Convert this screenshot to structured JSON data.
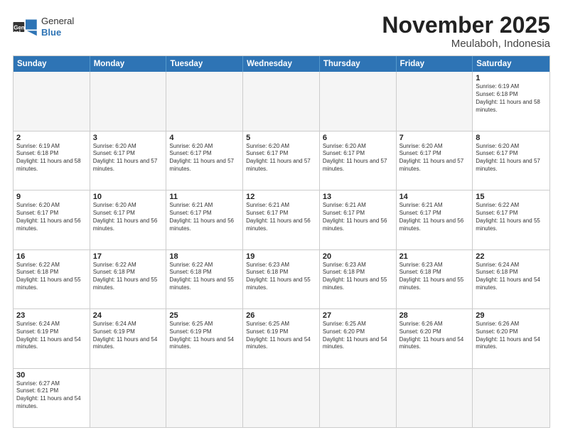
{
  "header": {
    "logo": {
      "general": "General",
      "blue": "Blue"
    },
    "title": "November 2025",
    "location": "Meulaboh, Indonesia"
  },
  "days_of_week": [
    "Sunday",
    "Monday",
    "Tuesday",
    "Wednesday",
    "Thursday",
    "Friday",
    "Saturday"
  ],
  "weeks": [
    [
      {
        "day": "",
        "empty": true
      },
      {
        "day": "",
        "empty": true
      },
      {
        "day": "",
        "empty": true
      },
      {
        "day": "",
        "empty": true
      },
      {
        "day": "",
        "empty": true
      },
      {
        "day": "",
        "empty": true
      },
      {
        "day": "1",
        "sunrise": "6:19 AM",
        "sunset": "6:18 PM",
        "daylight": "11 hours and 58 minutes."
      }
    ],
    [
      {
        "day": "2",
        "sunrise": "6:19 AM",
        "sunset": "6:18 PM",
        "daylight": "11 hours and 58 minutes."
      },
      {
        "day": "3",
        "sunrise": "6:20 AM",
        "sunset": "6:17 PM",
        "daylight": "11 hours and 57 minutes."
      },
      {
        "day": "4",
        "sunrise": "6:20 AM",
        "sunset": "6:17 PM",
        "daylight": "11 hours and 57 minutes."
      },
      {
        "day": "5",
        "sunrise": "6:20 AM",
        "sunset": "6:17 PM",
        "daylight": "11 hours and 57 minutes."
      },
      {
        "day": "6",
        "sunrise": "6:20 AM",
        "sunset": "6:17 PM",
        "daylight": "11 hours and 57 minutes."
      },
      {
        "day": "7",
        "sunrise": "6:20 AM",
        "sunset": "6:17 PM",
        "daylight": "11 hours and 57 minutes."
      },
      {
        "day": "8",
        "sunrise": "6:20 AM",
        "sunset": "6:17 PM",
        "daylight": "11 hours and 57 minutes."
      }
    ],
    [
      {
        "day": "9",
        "sunrise": "6:20 AM",
        "sunset": "6:17 PM",
        "daylight": "11 hours and 56 minutes."
      },
      {
        "day": "10",
        "sunrise": "6:20 AM",
        "sunset": "6:17 PM",
        "daylight": "11 hours and 56 minutes."
      },
      {
        "day": "11",
        "sunrise": "6:21 AM",
        "sunset": "6:17 PM",
        "daylight": "11 hours and 56 minutes."
      },
      {
        "day": "12",
        "sunrise": "6:21 AM",
        "sunset": "6:17 PM",
        "daylight": "11 hours and 56 minutes."
      },
      {
        "day": "13",
        "sunrise": "6:21 AM",
        "sunset": "6:17 PM",
        "daylight": "11 hours and 56 minutes."
      },
      {
        "day": "14",
        "sunrise": "6:21 AM",
        "sunset": "6:17 PM",
        "daylight": "11 hours and 56 minutes."
      },
      {
        "day": "15",
        "sunrise": "6:22 AM",
        "sunset": "6:17 PM",
        "daylight": "11 hours and 55 minutes."
      }
    ],
    [
      {
        "day": "16",
        "sunrise": "6:22 AM",
        "sunset": "6:18 PM",
        "daylight": "11 hours and 55 minutes."
      },
      {
        "day": "17",
        "sunrise": "6:22 AM",
        "sunset": "6:18 PM",
        "daylight": "11 hours and 55 minutes."
      },
      {
        "day": "18",
        "sunrise": "6:22 AM",
        "sunset": "6:18 PM",
        "daylight": "11 hours and 55 minutes."
      },
      {
        "day": "19",
        "sunrise": "6:23 AM",
        "sunset": "6:18 PM",
        "daylight": "11 hours and 55 minutes."
      },
      {
        "day": "20",
        "sunrise": "6:23 AM",
        "sunset": "6:18 PM",
        "daylight": "11 hours and 55 minutes."
      },
      {
        "day": "21",
        "sunrise": "6:23 AM",
        "sunset": "6:18 PM",
        "daylight": "11 hours and 55 minutes."
      },
      {
        "day": "22",
        "sunrise": "6:24 AM",
        "sunset": "6:18 PM",
        "daylight": "11 hours and 54 minutes."
      }
    ],
    [
      {
        "day": "23",
        "sunrise": "6:24 AM",
        "sunset": "6:19 PM",
        "daylight": "11 hours and 54 minutes."
      },
      {
        "day": "24",
        "sunrise": "6:24 AM",
        "sunset": "6:19 PM",
        "daylight": "11 hours and 54 minutes."
      },
      {
        "day": "25",
        "sunrise": "6:25 AM",
        "sunset": "6:19 PM",
        "daylight": "11 hours and 54 minutes."
      },
      {
        "day": "26",
        "sunrise": "6:25 AM",
        "sunset": "6:19 PM",
        "daylight": "11 hours and 54 minutes."
      },
      {
        "day": "27",
        "sunrise": "6:25 AM",
        "sunset": "6:20 PM",
        "daylight": "11 hours and 54 minutes."
      },
      {
        "day": "28",
        "sunrise": "6:26 AM",
        "sunset": "6:20 PM",
        "daylight": "11 hours and 54 minutes."
      },
      {
        "day": "29",
        "sunrise": "6:26 AM",
        "sunset": "6:20 PM",
        "daylight": "11 hours and 54 minutes."
      }
    ],
    [
      {
        "day": "30",
        "sunrise": "6:27 AM",
        "sunset": "6:21 PM",
        "daylight": "11 hours and 54 minutes."
      },
      {
        "day": "",
        "empty": true
      },
      {
        "day": "",
        "empty": true
      },
      {
        "day": "",
        "empty": true
      },
      {
        "day": "",
        "empty": true
      },
      {
        "day": "",
        "empty": true
      },
      {
        "day": "",
        "empty": true
      }
    ]
  ]
}
